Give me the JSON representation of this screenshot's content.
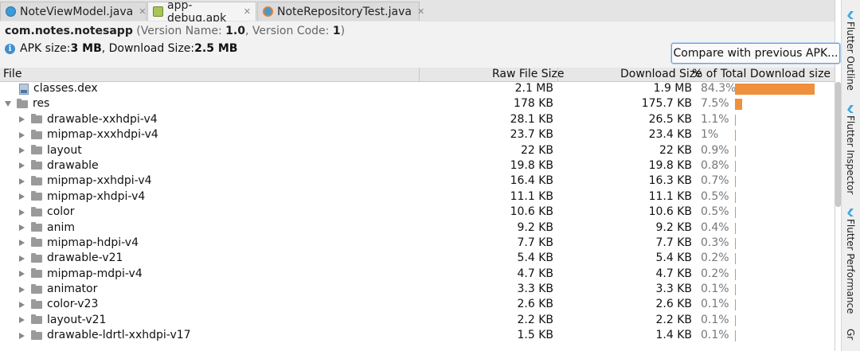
{
  "tabs": [
    {
      "label": "NoteViewModel.java",
      "icon": "java-class-icon"
    },
    {
      "label": "app-debug.apk",
      "icon": "apk-icon"
    },
    {
      "label": "NoteRepositoryTest.java",
      "icon": "java-test-icon"
    }
  ],
  "header": {
    "package": "com.notes.notesapp",
    "version_prefix": "(Version Name: ",
    "version_name": "1.0",
    "version_mid": ", Version Code: ",
    "version_code": "1",
    "version_suffix": ")",
    "apk_size_label": "APK size: ",
    "apk_size": "3 MB",
    "download_size_label": ", Download Size: ",
    "download_size": "2.5 MB",
    "compare_button": "Compare with previous APK..."
  },
  "columns": {
    "file": "File",
    "raw": "Raw File Size",
    "download": "Download Size",
    "percent": "% of Total Download size"
  },
  "rows": [
    {
      "name": "classes.dex",
      "type": "dex",
      "raw": "2.1 MB",
      "download": "1.9 MB",
      "percent": "84.3%",
      "share": 84.3
    },
    {
      "name": "res",
      "type": "folder-open",
      "raw": "178 KB",
      "download": "175.7 KB",
      "percent": "7.5%",
      "share": 7.5
    },
    {
      "name": "drawable-xxhdpi-v4",
      "type": "folder",
      "raw": "28.1 KB",
      "download": "26.5 KB",
      "percent": "1.1%",
      "share": 1.1
    },
    {
      "name": "mipmap-xxxhdpi-v4",
      "type": "folder",
      "raw": "23.7 KB",
      "download": "23.4 KB",
      "percent": "1%",
      "share": 1.0
    },
    {
      "name": "layout",
      "type": "folder",
      "raw": "22 KB",
      "download": "22 KB",
      "percent": "0.9%",
      "share": 0.9
    },
    {
      "name": "drawable",
      "type": "folder",
      "raw": "19.8 KB",
      "download": "19.8 KB",
      "percent": "0.8%",
      "share": 0.8
    },
    {
      "name": "mipmap-xxhdpi-v4",
      "type": "folder",
      "raw": "16.4 KB",
      "download": "16.3 KB",
      "percent": "0.7%",
      "share": 0.7
    },
    {
      "name": "mipmap-xhdpi-v4",
      "type": "folder",
      "raw": "11.1 KB",
      "download": "11.1 KB",
      "percent": "0.5%",
      "share": 0.5
    },
    {
      "name": "color",
      "type": "folder",
      "raw": "10.6 KB",
      "download": "10.6 KB",
      "percent": "0.5%",
      "share": 0.5
    },
    {
      "name": "anim",
      "type": "folder",
      "raw": "9.2 KB",
      "download": "9.2 KB",
      "percent": "0.4%",
      "share": 0.4
    },
    {
      "name": "mipmap-hdpi-v4",
      "type": "folder",
      "raw": "7.7 KB",
      "download": "7.7 KB",
      "percent": "0.3%",
      "share": 0.3
    },
    {
      "name": "drawable-v21",
      "type": "folder",
      "raw": "5.4 KB",
      "download": "5.4 KB",
      "percent": "0.2%",
      "share": 0.2
    },
    {
      "name": "mipmap-mdpi-v4",
      "type": "folder",
      "raw": "4.7 KB",
      "download": "4.7 KB",
      "percent": "0.2%",
      "share": 0.2
    },
    {
      "name": "animator",
      "type": "folder",
      "raw": "3.3 KB",
      "download": "3.3 KB",
      "percent": "0.1%",
      "share": 0.1
    },
    {
      "name": "color-v23",
      "type": "folder",
      "raw": "2.6 KB",
      "download": "2.6 KB",
      "percent": "0.1%",
      "share": 0.1
    },
    {
      "name": "layout-v21",
      "type": "folder",
      "raw": "2.2 KB",
      "download": "2.2 KB",
      "percent": "0.1%",
      "share": 0.1
    },
    {
      "name": "drawable-ldrtl-xxhdpi-v17",
      "type": "folder",
      "raw": "1.5 KB",
      "download": "1.4 KB",
      "percent": "0.1%",
      "share": 0.1
    }
  ],
  "side_tabs": [
    "Flutter Outline",
    "Flutter Inspector",
    "Flutter Performance",
    "Gr"
  ],
  "colors": {
    "bar": "#f08f3c",
    "accent": "#3f8fd2"
  }
}
